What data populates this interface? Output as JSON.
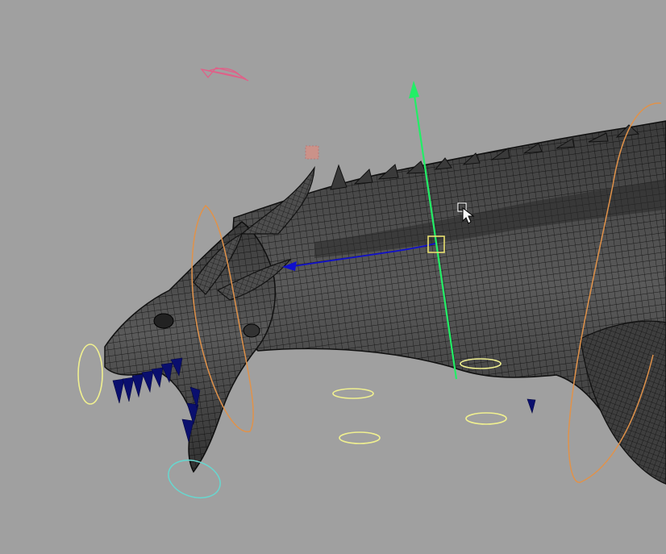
{
  "viewport": {
    "background": "#a0a0a0",
    "model": "dragon-head-neck-wireframe",
    "wire_color": "#1a1a1a",
    "shade_color": "#555555",
    "teeth_color": "#0a0f6e"
  },
  "manipulator": {
    "y_axis_color": "#22ee66",
    "x_axis_color": "#1010cc",
    "center_handle_color": "#e8e070"
  },
  "controls": {
    "ik_controls_color": "#f0f090",
    "orient_rings_color": "#e0924a",
    "locator_color": "#e06088",
    "jaw_control_color": "#66d8d0",
    "small_locator_color": "#e88a7a"
  },
  "cursor": {
    "icon": "arrow-cursor-icon"
  }
}
